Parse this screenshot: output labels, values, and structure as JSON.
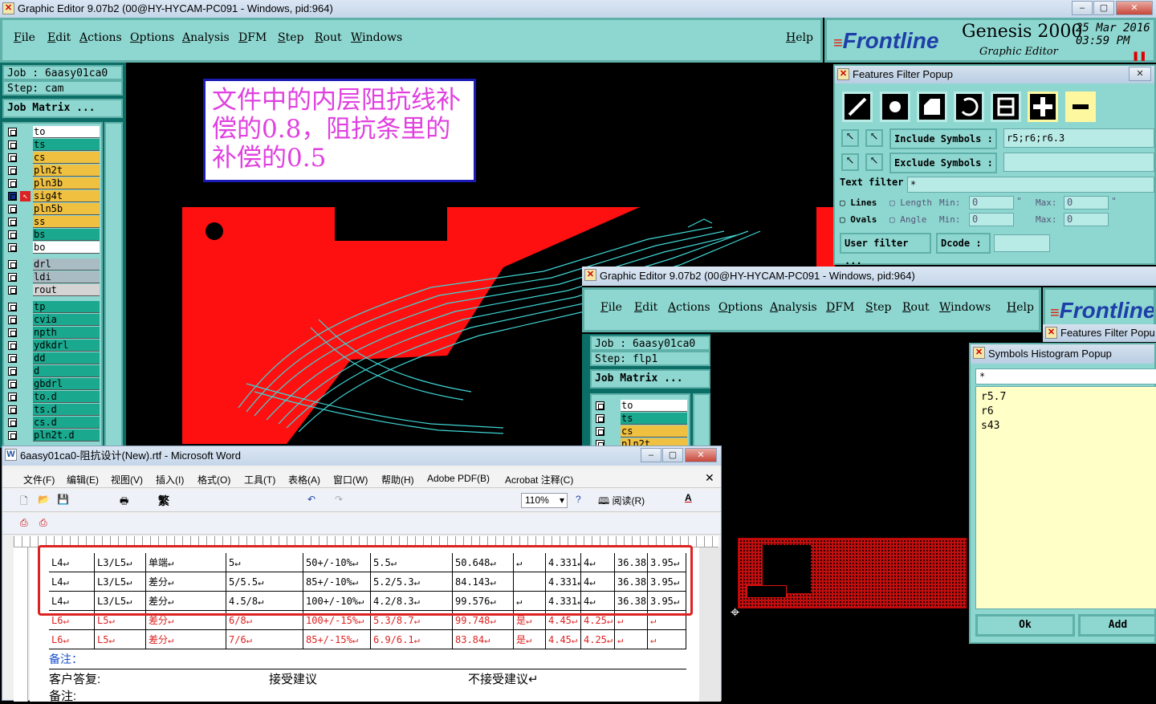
{
  "main_window": {
    "title": "Graphic Editor 9.07b2 (00@HY-HYCAM-PC091 - Windows, pid:964)"
  },
  "menu": [
    "File",
    "Edit",
    "Actions",
    "Options",
    "Analysis",
    "DFM",
    "Step",
    "Rout",
    "Windows"
  ],
  "help": "Help",
  "brand": {
    "logo": "Frontline",
    "product": "Genesis 2000",
    "subtitle": "Graphic Editor",
    "date": "25 Mar 2016",
    "time": "03:59 PM"
  },
  "job": {
    "job_label": "Job : 6aasy01ca0",
    "step_label": "Step: cam",
    "matrix_button": "Job Matrix ..."
  },
  "layers": [
    {
      "name": "to",
      "color": "#ffffff"
    },
    {
      "name": "ts",
      "color": "#1aa88e"
    },
    {
      "name": "cs",
      "color": "#f0c040"
    },
    {
      "name": "pln2t",
      "color": "#f0c040"
    },
    {
      "name": "pln3b",
      "color": "#f0c040"
    },
    {
      "name": "sig4t",
      "color": "#f0c040"
    },
    {
      "name": "pln5b",
      "color": "#f0c040"
    },
    {
      "name": "ss",
      "color": "#f0c040"
    },
    {
      "name": "bs",
      "color": "#1aa88e"
    },
    {
      "name": "bo",
      "color": "#ffffff"
    },
    {
      "name": "drl",
      "color": "#a9bcc4"
    },
    {
      "name": "ldi",
      "color": "#a9bcc4"
    },
    {
      "name": "rout",
      "color": "#d4d4d4"
    },
    {
      "name": "tp",
      "color": "#1aa88e"
    },
    {
      "name": "cvia",
      "color": "#1aa88e"
    },
    {
      "name": "npth",
      "color": "#1aa88e"
    },
    {
      "name": "ydkdrl",
      "color": "#1aa88e"
    },
    {
      "name": "dd",
      "color": "#1aa88e"
    },
    {
      "name": "d",
      "color": "#1aa88e"
    },
    {
      "name": "gbdrl",
      "color": "#1aa88e"
    },
    {
      "name": "to.d",
      "color": "#1aa88e"
    },
    {
      "name": "ts.d",
      "color": "#1aa88e"
    },
    {
      "name": "cs.d",
      "color": "#1aa88e"
    },
    {
      "name": "pln2t.d",
      "color": "#1aa88e"
    }
  ],
  "note_box": {
    "text": "文件中的内层阻抗线补偿的0.8，阻抗条里的补偿的0.5"
  },
  "features_filter": {
    "title": "Features Filter Popup",
    "include_label": "Include Symbols :",
    "include_value": "r5;r6;r6.3",
    "exclude_label": "Exclude Symbols :",
    "exclude_value": "",
    "text_filter_label": "Text filter",
    "text_filter_value": "*",
    "lines": "Lines",
    "ovals": "Ovals",
    "length": "Length",
    "angle": "Angle",
    "min": "Min:",
    "max": "Max:",
    "min_val": "0",
    "max_val": "0",
    "unit": "\"",
    "user_filter": "User filter ...",
    "dcode": "Dcode :"
  },
  "second_window": {
    "title": "Graphic Editor 9.07b2 (00@HY-HYCAM-PC091 - Windows, pid:964)",
    "job_label": "Job : 6aasy01ca0",
    "step_label": "Step: flp1",
    "matrix_button": "Job Matrix ...",
    "layers": [
      {
        "name": "to",
        "color": "#ffffff"
      },
      {
        "name": "ts",
        "color": "#1aa88e"
      },
      {
        "name": "cs",
        "color": "#f0c040"
      },
      {
        "name": "pln2t",
        "color": "#f0c040"
      }
    ],
    "popup_title": "Features Filter Popu"
  },
  "histogram": {
    "title": "Symbols Histogram Popup",
    "filter": "*",
    "symbols": [
      "r5.7",
      "r6",
      "s43"
    ],
    "ok": "Ok",
    "add": "Add"
  },
  "word": {
    "title": "6aasy01ca0-阻抗设计(New).rtf - Microsoft Word",
    "menu": [
      "文件(F)",
      "编辑(E)",
      "视图(V)",
      "插入(I)",
      "格式(O)",
      "工具(T)",
      "表格(A)",
      "窗口(W)",
      "帮助(H)",
      "Adobe PDF(B)",
      "Acrobat 注释(C)"
    ],
    "zoom": "110%",
    "trad_label": "繁",
    "read_label": "阅读(R)",
    "rows": [
      {
        "c": [
          "L4↵",
          "L3/L5↵",
          "单端↵",
          "5↵",
          "50+/-10%↵",
          "5.5↵",
          "50.648↵",
          "↵",
          "4.331↵",
          "4↵",
          "36.388↵",
          "3.95↵"
        ],
        "red": false
      },
      {
        "c": [
          "L4↵",
          "L3/L5↵",
          "差分↵",
          "5/5.5↵",
          "85+/-10%↵",
          "5.2/5.3↵",
          "84.143↵",
          "",
          "4.331↵",
          "4↵",
          "36.388↵",
          "3.95↵"
        ],
        "red": false
      },
      {
        "c": [
          "L4↵",
          "L3/L5↵",
          "差分↵",
          "4.5/8↵",
          "100+/-10%↵",
          "4.2/8.3↵",
          "99.576↵",
          "↵",
          "4.331↵",
          "4↵",
          "36.388↵",
          "3.95↵"
        ],
        "red": false
      },
      {
        "c": [
          "L6↵",
          "L5↵",
          "差分↵",
          "6/8↵",
          "100+/-15%↵",
          "5.3/8.7↵",
          "99.748↵",
          "是↵",
          "4.45↵",
          "4.25↵",
          "↵",
          "↵"
        ],
        "red": true
      },
      {
        "c": [
          "L6↵",
          "L5↵",
          "差分↵",
          "7/6↵",
          "85+/-15%↵",
          "6.9/6.1↵",
          "83.84↵",
          "是↵",
          "4.45↵",
          "4.25↵",
          "↵",
          "↵"
        ],
        "red": true
      }
    ],
    "remark": "备注：",
    "reply_label": "客户答复:",
    "accept": "接受建议",
    "reject": "不接受建议↵",
    "remark2": "备注:"
  }
}
